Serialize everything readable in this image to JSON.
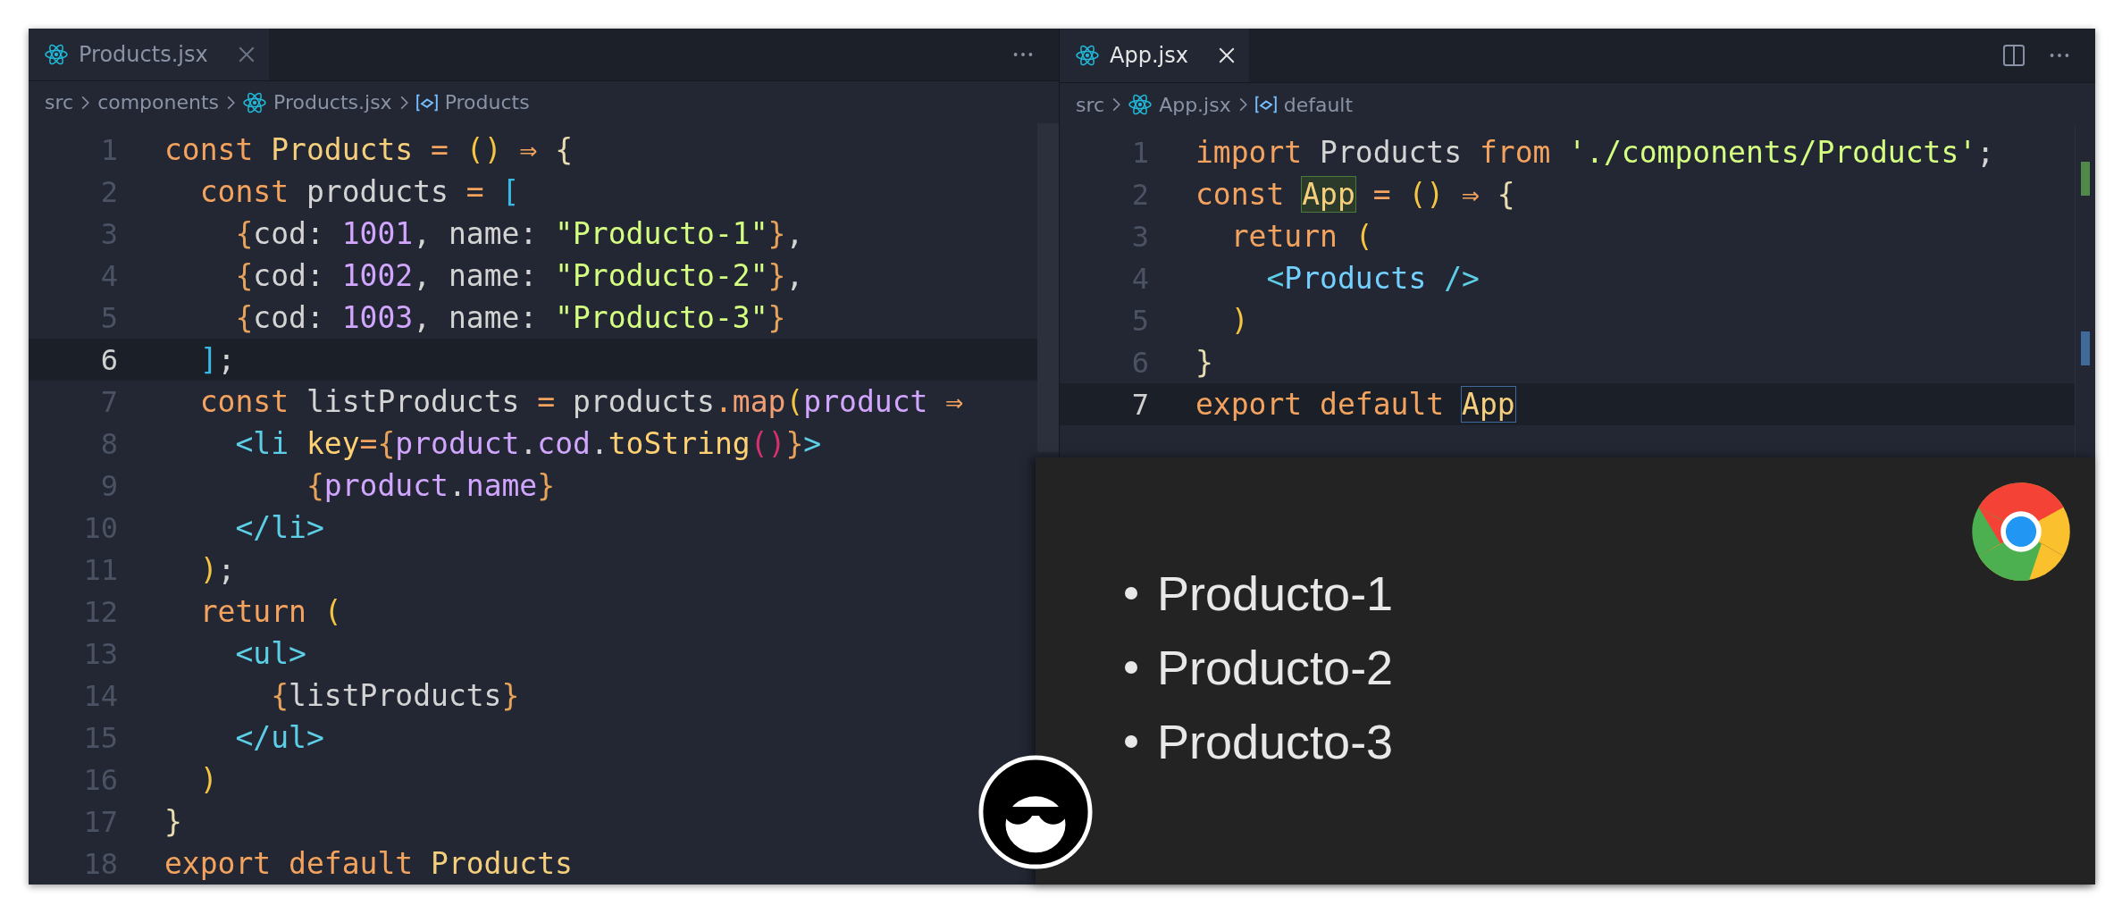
{
  "left_editor": {
    "focused": false,
    "tab": {
      "label": "Products.jsx"
    },
    "breadcrumb": [
      {
        "kind": "folder",
        "label": "src"
      },
      {
        "kind": "folder",
        "label": "components"
      },
      {
        "kind": "file",
        "label": "Products.jsx"
      },
      {
        "kind": "symbol",
        "label": "Products"
      }
    ],
    "lines": [
      {
        "number": "1",
        "current": false,
        "tokens": [
          {
            "kind": "kw",
            "text": "const "
          },
          {
            "kind": "fn",
            "text": "Products"
          },
          {
            "kind": "op",
            "text": " = "
          },
          {
            "kind": "paren",
            "text": "()"
          },
          {
            "kind": "op",
            "text": " ⇒ "
          },
          {
            "kind": "punct",
            "text": "{"
          }
        ]
      },
      {
        "number": "2",
        "current": false,
        "tokens": [
          {
            "kind": "kw",
            "text": "  const "
          },
          {
            "kind": "plain",
            "text": "products"
          },
          {
            "kind": "op",
            "text": " = "
          },
          {
            "kind": "bracket",
            "text": "["
          }
        ]
      },
      {
        "number": "3",
        "current": false,
        "tokens": [
          {
            "kind": "brace",
            "text": "    {"
          },
          {
            "kind": "plain",
            "text": "cod: "
          },
          {
            "kind": "num",
            "text": "1001"
          },
          {
            "kind": "plain",
            "text": ", name: "
          },
          {
            "kind": "str",
            "text": "\"Producto-1\""
          },
          {
            "kind": "brace",
            "text": "}"
          },
          {
            "kind": "plain",
            "text": ","
          }
        ]
      },
      {
        "number": "4",
        "current": false,
        "tokens": [
          {
            "kind": "brace",
            "text": "    {"
          },
          {
            "kind": "plain",
            "text": "cod: "
          },
          {
            "kind": "num",
            "text": "1002"
          },
          {
            "kind": "plain",
            "text": ", name: "
          },
          {
            "kind": "str",
            "text": "\"Producto-2\""
          },
          {
            "kind": "brace",
            "text": "}"
          },
          {
            "kind": "plain",
            "text": ","
          }
        ]
      },
      {
        "number": "5",
        "current": false,
        "tokens": [
          {
            "kind": "brace",
            "text": "    {"
          },
          {
            "kind": "plain",
            "text": "cod: "
          },
          {
            "kind": "num",
            "text": "1003"
          },
          {
            "kind": "plain",
            "text": ", name: "
          },
          {
            "kind": "str",
            "text": "\"Producto-3\""
          },
          {
            "kind": "brace",
            "text": "}"
          }
        ]
      },
      {
        "number": "6",
        "current": true,
        "tokens": [
          {
            "kind": "bracket",
            "text": "  ]"
          },
          {
            "kind": "plain",
            "text": ";"
          }
        ]
      },
      {
        "number": "7",
        "current": false,
        "tokens": [
          {
            "kind": "kw",
            "text": "  const "
          },
          {
            "kind": "plain",
            "text": "listProducts"
          },
          {
            "kind": "op",
            "text": " = "
          },
          {
            "kind": "plain",
            "text": "products"
          },
          {
            "kind": "op",
            "text": "."
          },
          {
            "kind": "method",
            "text": "map"
          },
          {
            "kind": "paren",
            "text": "("
          },
          {
            "kind": "prop",
            "text": "product"
          },
          {
            "kind": "op",
            "text": " ⇒"
          }
        ]
      },
      {
        "number": "8",
        "current": false,
        "tokens": [
          {
            "kind": "tag",
            "text": "    <li "
          },
          {
            "kind": "attr",
            "text": "key"
          },
          {
            "kind": "op",
            "text": "="
          },
          {
            "kind": "brace",
            "text": "{"
          },
          {
            "kind": "prop",
            "text": "product"
          },
          {
            "kind": "plain",
            "text": "."
          },
          {
            "kind": "prop",
            "text": "cod"
          },
          {
            "kind": "plain",
            "text": "."
          },
          {
            "kind": "attr",
            "text": "toString"
          },
          {
            "kind": "call",
            "text": "()"
          },
          {
            "kind": "brace",
            "text": "}"
          },
          {
            "kind": "tag",
            "text": ">"
          }
        ]
      },
      {
        "number": "9",
        "current": false,
        "tokens": [
          {
            "kind": "brace",
            "text": "        {"
          },
          {
            "kind": "prop",
            "text": "product"
          },
          {
            "kind": "plain",
            "text": "."
          },
          {
            "kind": "prop",
            "text": "name"
          },
          {
            "kind": "brace",
            "text": "}"
          }
        ]
      },
      {
        "number": "10",
        "current": false,
        "tokens": [
          {
            "kind": "tag",
            "text": "    </li>"
          }
        ]
      },
      {
        "number": "11",
        "current": false,
        "tokens": [
          {
            "kind": "paren",
            "text": "  )"
          },
          {
            "kind": "plain",
            "text": ";"
          }
        ]
      },
      {
        "number": "12",
        "current": false,
        "tokens": [
          {
            "kind": "kw",
            "text": "  return "
          },
          {
            "kind": "paren",
            "text": "("
          }
        ]
      },
      {
        "number": "13",
        "current": false,
        "tokens": [
          {
            "kind": "tag",
            "text": "    <ul>"
          }
        ]
      },
      {
        "number": "14",
        "current": false,
        "tokens": [
          {
            "kind": "brace",
            "text": "      {"
          },
          {
            "kind": "plain",
            "text": "listProducts"
          },
          {
            "kind": "brace",
            "text": "}"
          }
        ]
      },
      {
        "number": "15",
        "current": false,
        "tokens": [
          {
            "kind": "tag",
            "text": "    </ul>"
          }
        ]
      },
      {
        "number": "16",
        "current": false,
        "tokens": [
          {
            "kind": "paren",
            "text": "  )"
          }
        ]
      },
      {
        "number": "17",
        "current": false,
        "tokens": [
          {
            "kind": "punct",
            "text": "}"
          }
        ]
      },
      {
        "number": "18",
        "current": false,
        "tokens": [
          {
            "kind": "kw",
            "text": "export default "
          },
          {
            "kind": "fn",
            "text": "Products"
          }
        ]
      }
    ]
  },
  "right_editor": {
    "focused": true,
    "tab": {
      "label": "App.jsx"
    },
    "breadcrumb": [
      {
        "kind": "folder",
        "label": "src"
      },
      {
        "kind": "file",
        "label": "App.jsx"
      },
      {
        "kind": "symbol",
        "label": "default"
      }
    ],
    "lines": [
      {
        "number": "1",
        "current": false,
        "tokens": [
          {
            "kind": "kw",
            "text": "import "
          },
          {
            "kind": "plain",
            "text": "Products "
          },
          {
            "kind": "kw",
            "text": "from "
          },
          {
            "kind": "str",
            "text": "'./components/Products'"
          },
          {
            "kind": "plain",
            "text": ";"
          }
        ]
      },
      {
        "number": "2",
        "current": false,
        "tokens": [
          {
            "kind": "kw",
            "text": "const "
          },
          {
            "kind": "defbox",
            "text": "App"
          },
          {
            "kind": "op",
            "text": " = "
          },
          {
            "kind": "paren",
            "text": "()"
          },
          {
            "kind": "op",
            "text": " ⇒ "
          },
          {
            "kind": "punct",
            "text": "{"
          }
        ]
      },
      {
        "number": "3",
        "current": false,
        "tokens": [
          {
            "kind": "kw",
            "text": "  return "
          },
          {
            "kind": "paren",
            "text": "("
          }
        ]
      },
      {
        "number": "4",
        "current": false,
        "tokens": [
          {
            "kind": "tag",
            "text": "    <"
          },
          {
            "kind": "component",
            "text": "Products"
          },
          {
            "kind": "tag",
            "text": " />"
          }
        ]
      },
      {
        "number": "5",
        "current": false,
        "tokens": [
          {
            "kind": "paren",
            "text": "  )"
          }
        ]
      },
      {
        "number": "6",
        "current": false,
        "tokens": [
          {
            "kind": "punct",
            "text": "}"
          }
        ]
      },
      {
        "number": "7",
        "current": true,
        "tokens": [
          {
            "kind": "kw",
            "text": "export default "
          },
          {
            "kind": "refbox",
            "text": "App"
          }
        ]
      }
    ]
  },
  "browser_preview": {
    "items": [
      "Producto-1",
      "Producto-2",
      "Producto-3"
    ]
  }
}
